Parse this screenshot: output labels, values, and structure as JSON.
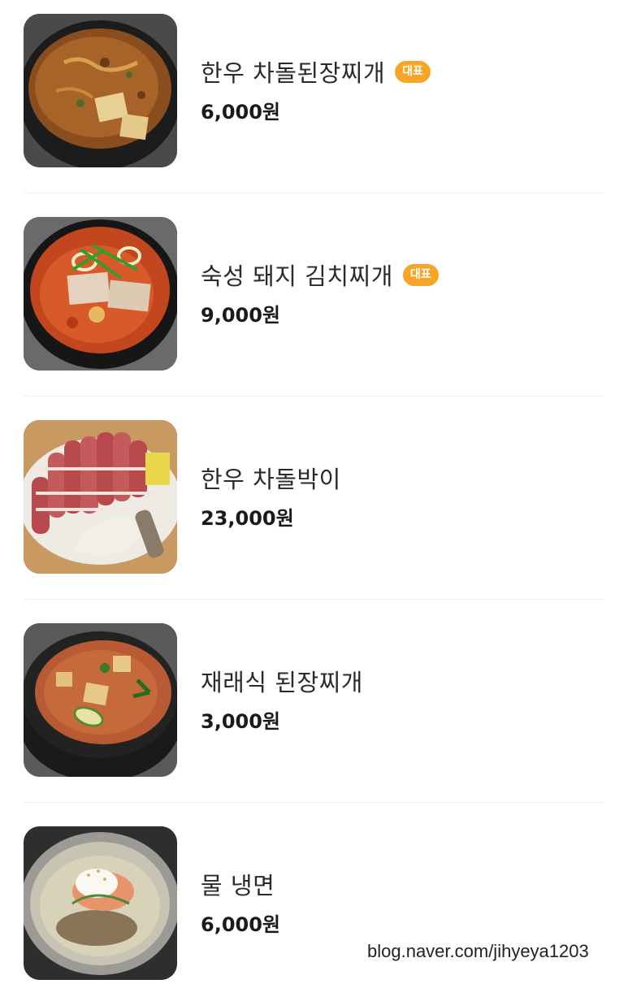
{
  "menu": {
    "items": [
      {
        "name": "한우 차돌된장찌개",
        "badge": "대표",
        "price": "6,000원",
        "photo": "doenjang-stew-photo"
      },
      {
        "name": "숙성 돼지 김치찌개",
        "badge": "대표",
        "price": "9,000원",
        "photo": "kimchi-stew-photo"
      },
      {
        "name": "한우 차돌박이",
        "badge": "",
        "price": "23,000원",
        "photo": "brisket-photo"
      },
      {
        "name": "재래식 된장찌개",
        "badge": "",
        "price": "3,000원",
        "photo": "traditional-doenjang-photo"
      },
      {
        "name": "물 냉면",
        "badge": "",
        "price": "6,000원",
        "photo": "cold-noodle-photo"
      }
    ]
  },
  "colors": {
    "badge": "#f8a428",
    "divider": "#efefef",
    "text": "#222222"
  },
  "watermark": "blog.naver.com/jihyeya1203"
}
